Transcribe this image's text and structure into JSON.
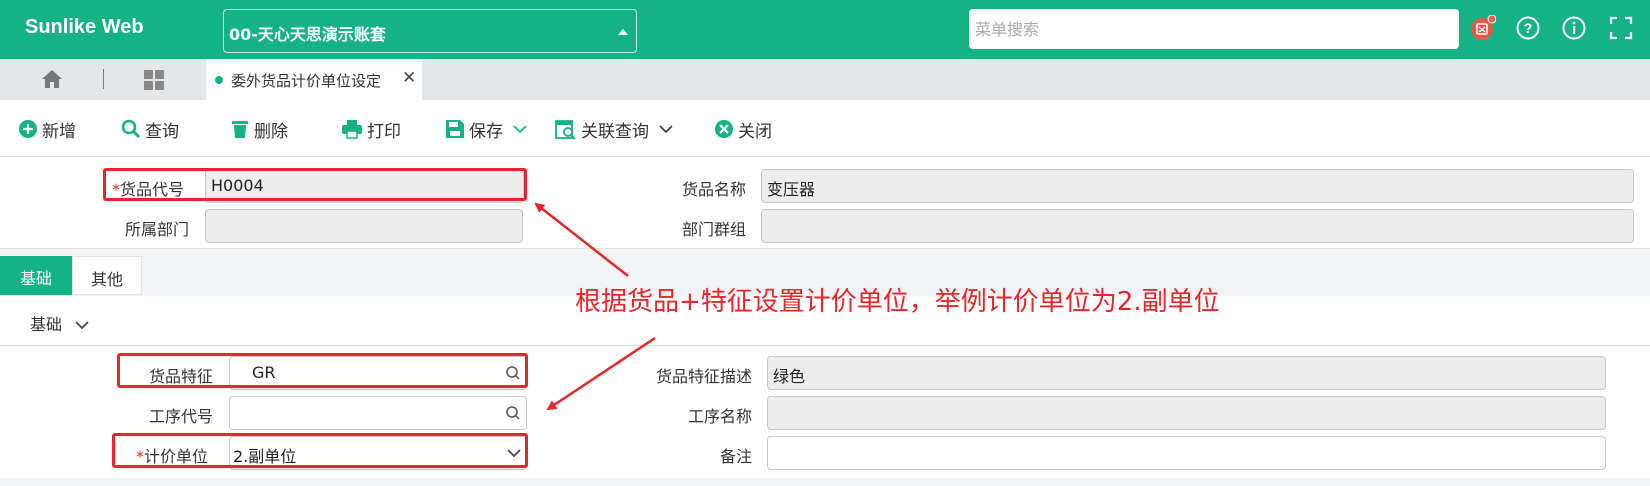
{
  "header": {
    "brand": "Sunlike Web",
    "account": "00-天心天思演示账套",
    "search_placeholder": "菜单搜索",
    "accent": "#14b285"
  },
  "tabs": {
    "home_icon": "home-icon",
    "grid_icon": "apps-grid-icon",
    "active_tab": "委外货品计价单位设定",
    "close_glyph": "✕"
  },
  "toolbar": {
    "new": "新增",
    "query": "查询",
    "delete": "删除",
    "print": "打印",
    "save": "保存",
    "related": "关联查询",
    "close": "关闭"
  },
  "header_form": {
    "item_code_label": "货品代号",
    "item_code": "H0004",
    "item_name_label": "货品名称",
    "item_name": "变压器",
    "dept_label": "所属部门",
    "dept": "",
    "dept_group_label": "部门群组",
    "dept_group": ""
  },
  "section_tabs": {
    "basic": "基础",
    "other": "其他"
  },
  "group_title": "基础",
  "detail_form": {
    "feature_label": "货品特征",
    "feature": "GR",
    "feature_desc_label": "货品特征描述",
    "feature_desc": "绿色",
    "process_code_label": "工序代号",
    "process_code": "",
    "process_name_label": "工序名称",
    "process_name": "",
    "unit_label": "计价单位",
    "unit": "2.副单位",
    "remark_label": "备注",
    "remark": ""
  },
  "required_mark": "*",
  "annotation": "根据货品+特征设置计价单位，举例计价单位为2.副单位",
  "annotation_color": "#e8252b"
}
